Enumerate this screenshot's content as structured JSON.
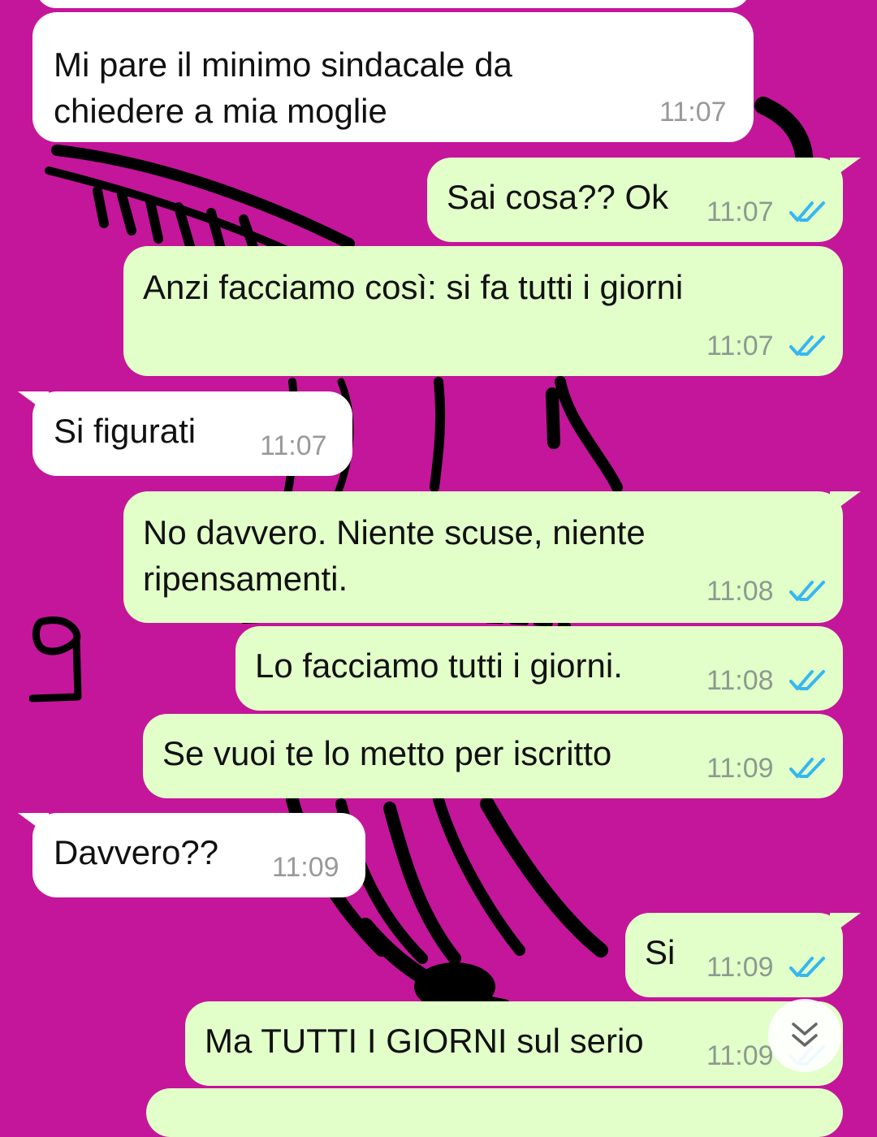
{
  "chat": {
    "messages": [
      {
        "text": "Mi pare il minimo sindacale da\nchiedere a mia moglie",
        "time": "11:07",
        "direction": "incoming"
      },
      {
        "text": "Sai cosa?? Ok",
        "time": "11:07",
        "direction": "outgoing",
        "status": "read"
      },
      {
        "text": "Anzi facciamo così: si fa tutti i giorni",
        "time": "11:07",
        "direction": "outgoing",
        "status": "read"
      },
      {
        "text": "Si figurati",
        "time": "11:07",
        "direction": "incoming"
      },
      {
        "text": "No davvero. Niente scuse, niente\nripensamenti.",
        "time": "11:08",
        "direction": "outgoing",
        "status": "read"
      },
      {
        "text": "Lo facciamo tutti i giorni.",
        "time": "11:08",
        "direction": "outgoing",
        "status": "read"
      },
      {
        "text": "Se vuoi te lo metto per iscritto",
        "time": "11:09",
        "direction": "outgoing",
        "status": "read"
      },
      {
        "text": "Davvero??",
        "time": "11:09",
        "direction": "incoming"
      },
      {
        "text": "Si",
        "time": "11:09",
        "direction": "outgoing",
        "status": "read"
      },
      {
        "text": "Ma TUTTI I GIORNI sul serio",
        "time": "11:09",
        "direction": "outgoing",
        "status": "read"
      }
    ]
  },
  "annotation": {
    "text": "9"
  },
  "colors": {
    "wallpaper": "#c4169a",
    "incoming_bubble": "#ffffff",
    "outgoing_bubble": "#e2ffc9",
    "read_ticks": "#34b7f1"
  },
  "icons": {
    "read_receipt": "double-check-icon",
    "scroll_down": "double-chevron-down-icon"
  }
}
